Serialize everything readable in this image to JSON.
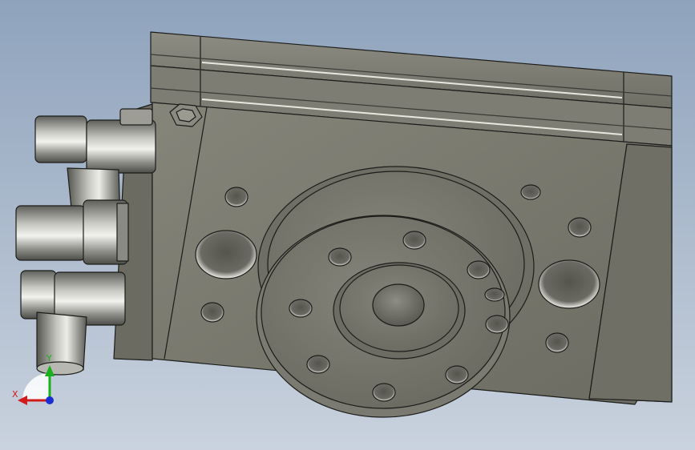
{
  "viewport": {
    "colors": {
      "background_top": "#8fa3bd",
      "background_bottom": "#c9d2de",
      "body": "#76766b",
      "edge": "#1c1c1a"
    }
  },
  "triad": {
    "x_label": "X",
    "y_label": "Y",
    "x_color": "#d11a1a",
    "y_color": "#19b11b",
    "z_color": "#1a2fd1"
  }
}
